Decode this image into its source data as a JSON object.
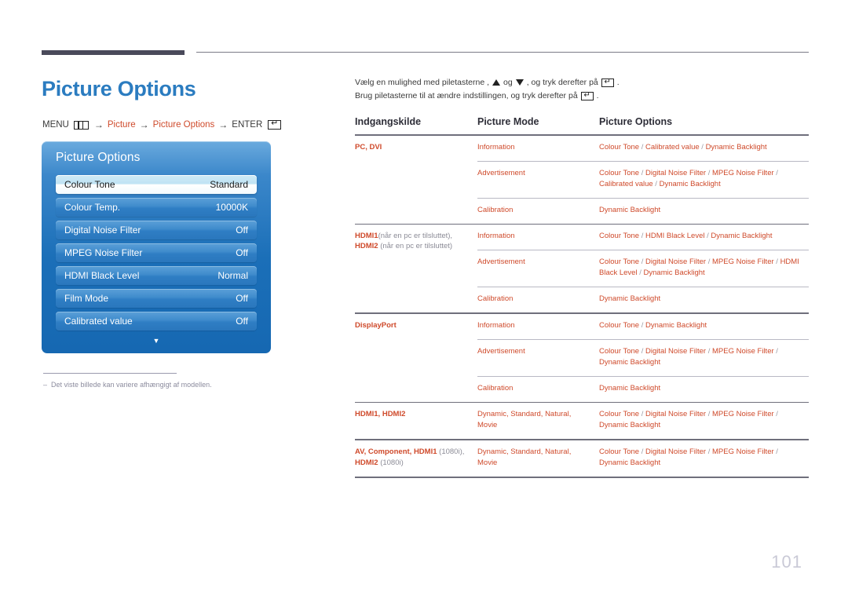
{
  "document": {
    "page_number": "101",
    "title": "Picture Options"
  },
  "breadcrumb": {
    "menu_label": "MENU",
    "menu_icon": "menu-bars-icon",
    "arrow": "→",
    "step1": "Picture",
    "step2": "Picture Options",
    "enter_label": "ENTER",
    "enter_icon": "enter-key-icon"
  },
  "osd": {
    "title": "Picture Options",
    "rows": [
      {
        "label": "Colour Tone",
        "value": "Standard",
        "selected": true
      },
      {
        "label": "Colour Temp.",
        "value": "10000K",
        "selected": false
      },
      {
        "label": "Digital Noise Filter",
        "value": "Off",
        "selected": false
      },
      {
        "label": "MPEG Noise Filter",
        "value": "Off",
        "selected": false
      },
      {
        "label": "HDMI Black Level",
        "value": "Normal",
        "selected": false
      },
      {
        "label": "Film Mode",
        "value": "Off",
        "selected": false
      },
      {
        "label": "Calibrated value",
        "value": "Off",
        "selected": false
      }
    ],
    "more_icon": "chevron-down-icon"
  },
  "footnote": {
    "dash": "–",
    "text": "Det viste billede kan variere afhængigt af modellen."
  },
  "instructions": {
    "line1_a": "Vælg en mulighed med piletasterne ,",
    "line1_b": "og",
    "line1_c": ", og tryk derefter på",
    "line1_d": ".",
    "up_icon": "triangle-up-icon",
    "down_icon": "triangle-down-icon",
    "enter_icon": "enter-key-icon",
    "line2_a": "Brug piletasterne til at ændre indstillingen, og tryk derefter på",
    "line2_b": "."
  },
  "table": {
    "headers": {
      "col1": "Indgangskilde",
      "col2": "Picture Mode",
      "col3": "Picture Options"
    },
    "groups": [
      {
        "source_parts": [
          {
            "text": "PC, DVI",
            "style": "strong"
          }
        ],
        "rows": [
          {
            "mode": "Information",
            "options": "Colour Tone / Calibrated value / Dynamic Backlight"
          },
          {
            "mode": "Advertisement",
            "options": "Colour Tone / Digital Noise Filter / MPEG Noise Filter / Calibrated value / Dynamic Backlight"
          },
          {
            "mode": "Calibration",
            "options": "Dynamic Backlight"
          }
        ]
      },
      {
        "source_parts": [
          {
            "text": "HDMI1",
            "style": "strong"
          },
          {
            "text": "(når en pc er tilsluttet),",
            "style": "muted"
          },
          {
            "text": "HDMI2",
            "style": "strong"
          },
          {
            "text": "(når en pc er tilsluttet)",
            "style": "muted"
          }
        ],
        "rows": [
          {
            "mode": "Information",
            "options": "Colour Tone / HDMI Black Level / Dynamic Backlight"
          },
          {
            "mode": "Advertisement",
            "options": "Colour Tone / Digital Noise Filter / MPEG Noise Filter / HDMI Black Level / Dynamic Backlight"
          },
          {
            "mode": "Calibration",
            "options": "Dynamic Backlight"
          }
        ]
      },
      {
        "source_parts": [
          {
            "text": "DisplayPort",
            "style": "strong"
          }
        ],
        "rows": [
          {
            "mode": "Information",
            "options": "Colour Tone / Dynamic Backlight"
          },
          {
            "mode": "Advertisement",
            "options": "Colour Tone / Digital Noise Filter / MPEG Noise Filter / Dynamic Backlight"
          },
          {
            "mode": "Calibration",
            "options": "Dynamic Backlight"
          }
        ]
      }
    ],
    "flat_rows": [
      {
        "source_parts": [
          {
            "text": "HDMI1, HDMI2",
            "style": "strong"
          }
        ],
        "mode": "Dynamic, Standard, Natural, Movie",
        "options": "Colour Tone / Digital Noise Filter / MPEG Noise Filter / Dynamic Backlight"
      },
      {
        "source_parts": [
          {
            "text": "AV, Component, HDMI1",
            "style": "strong"
          },
          {
            "text": "(1080i),",
            "style": "muted"
          },
          {
            "text": "HDMI2",
            "style": "strong"
          },
          {
            "text": "(1080i)",
            "style": "muted"
          }
        ],
        "mode": "Dynamic, Standard, Natural, Movie",
        "options": "Colour Tone / Digital Noise Filter / MPEG Noise Filter / Dynamic Backlight"
      }
    ]
  }
}
